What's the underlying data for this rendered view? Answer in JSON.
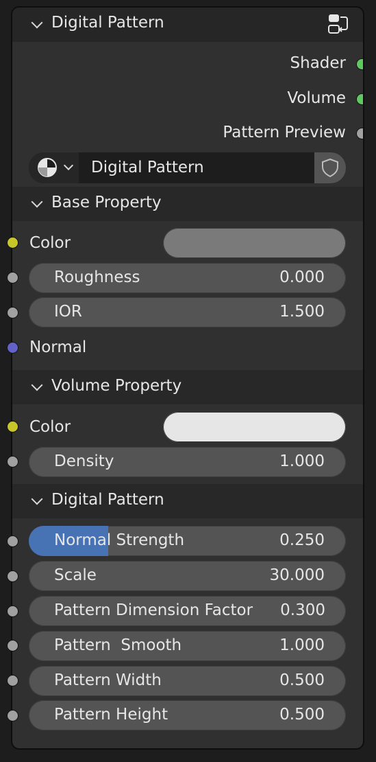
{
  "node": {
    "title": "Digital Pattern",
    "outputs": [
      {
        "label": "Shader",
        "color": "#5fc95f"
      },
      {
        "label": "Volume",
        "color": "#5fc95f"
      },
      {
        "label": "Pattern Preview",
        "color": "#a1a1a1"
      }
    ],
    "datablock": {
      "icon": "node-tree-icon",
      "name": "Digital Pattern",
      "fake_user_icon": "shield-icon"
    },
    "panels": {
      "base": {
        "title": "Base Property",
        "color_label": "Color",
        "color_value": "#7a7a7a",
        "roughness_label": "Roughness",
        "roughness_value": "0.000",
        "ior_label": "IOR",
        "ior_value": "1.500",
        "normal_label": "Normal"
      },
      "volume": {
        "title": "Volume Property",
        "color_label": "Color",
        "color_value": "#e6e6e6",
        "density_label": "Density",
        "density_value": "1.000"
      },
      "pattern": {
        "title": "Digital Pattern",
        "fields": [
          {
            "label": "Normal Strength",
            "value": "0.250",
            "fill_fraction": 0.25
          },
          {
            "label": "Scale",
            "value": "30.000"
          },
          {
            "label": "Pattern Dimension Factor",
            "value": "0.300"
          },
          {
            "label": "Pattern  Smooth",
            "value": "1.000"
          },
          {
            "label": "Pattern Width",
            "value": "0.500"
          },
          {
            "label": "Pattern Height",
            "value": "0.500"
          }
        ]
      }
    },
    "socket_colors": {
      "color": "#c7c729",
      "float": "#a1a1a1",
      "vector": "#6363c7",
      "shader": "#5fc95f"
    },
    "accent": "#4772b3"
  }
}
